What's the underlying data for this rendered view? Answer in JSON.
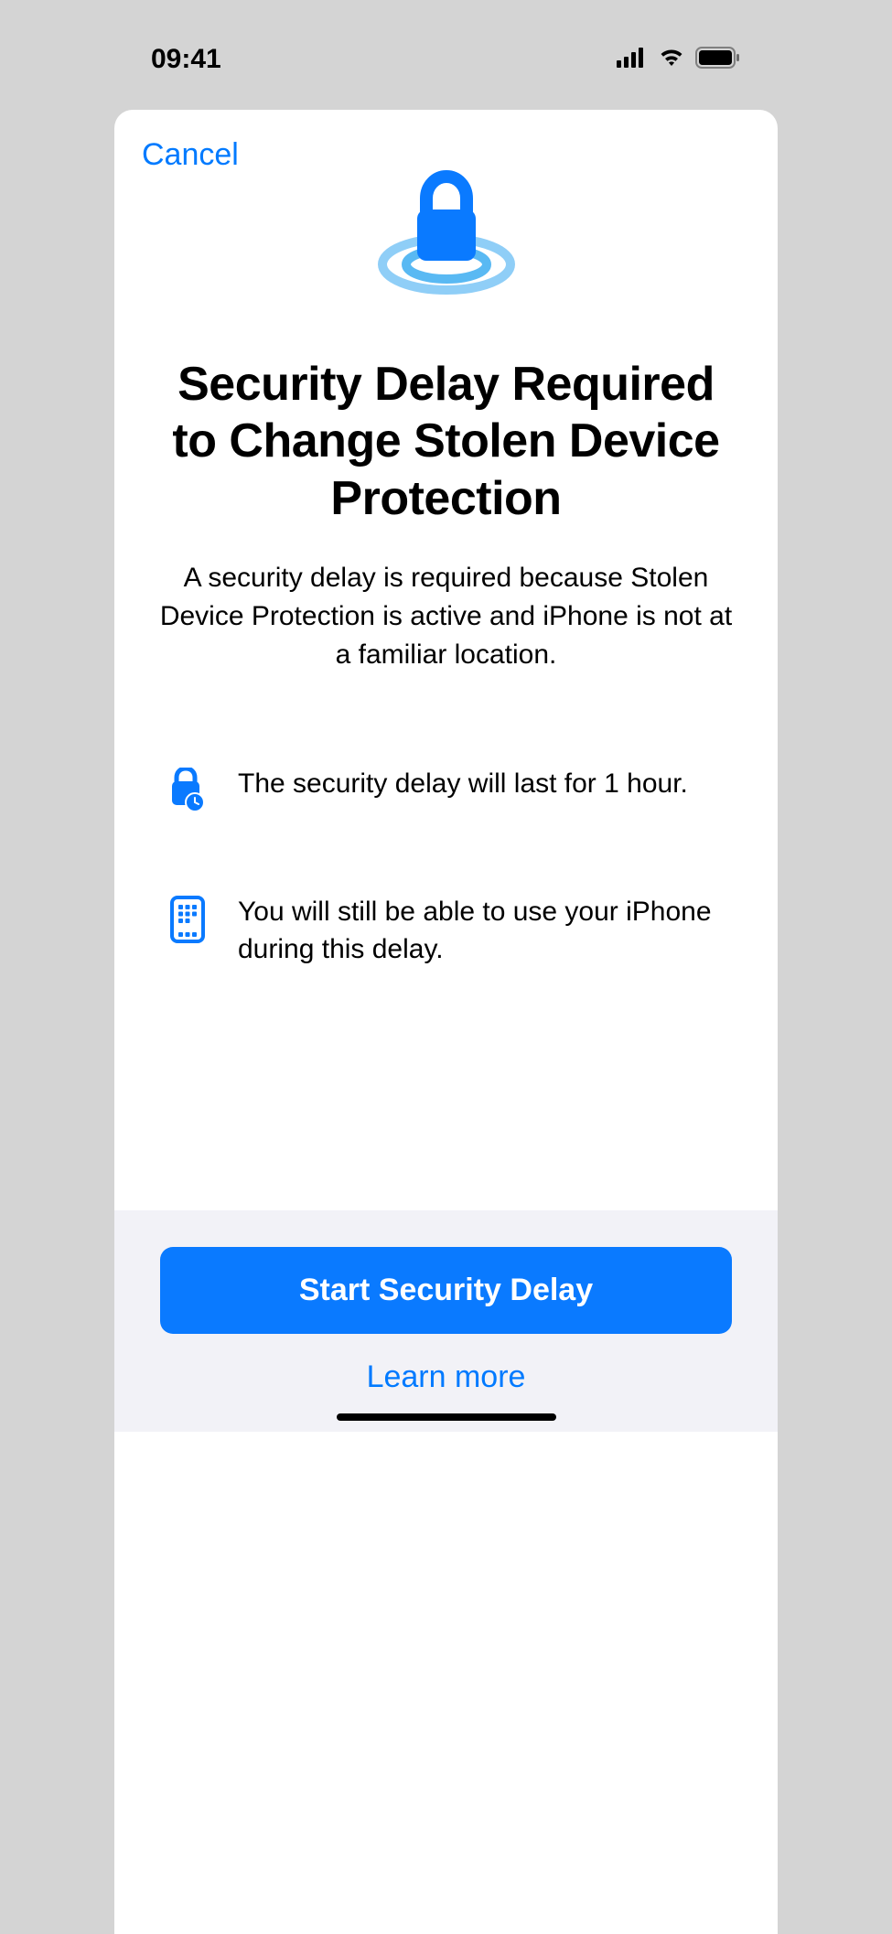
{
  "statusBar": {
    "time": "09:41"
  },
  "sheet": {
    "cancel": "Cancel",
    "title": "Security Delay Required to Change Stolen Device Protection",
    "subtitle": "A security delay is required because Stolen Device Protection is active and iPhone is not at a familiar location.",
    "info": [
      {
        "text": "The security delay will last for 1 hour."
      },
      {
        "text": "You will still be able to use your iPhone during this delay."
      }
    ],
    "primaryButton": "Start Security Delay",
    "secondaryButton": "Learn more"
  }
}
